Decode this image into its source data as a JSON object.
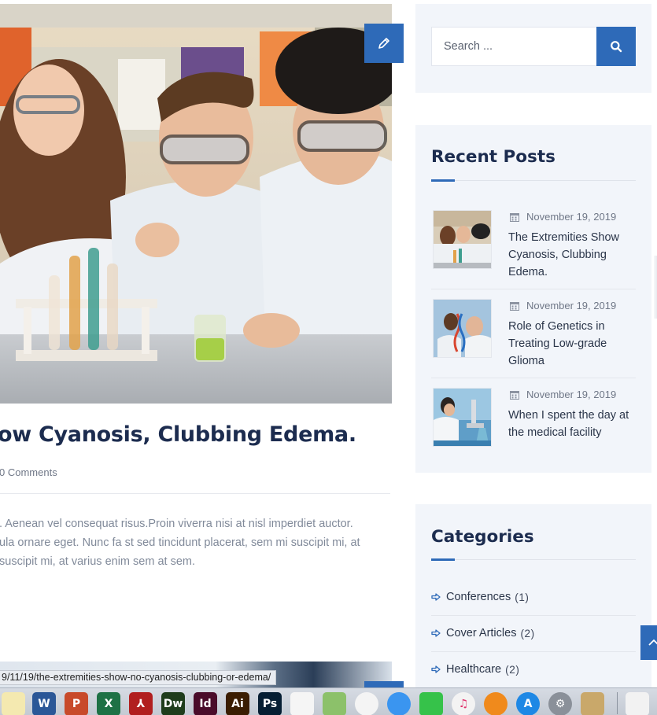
{
  "post": {
    "title": "ow Cyanosis, Clubbing Edema.",
    "meta": "0 Comments",
    "excerpt_lines": [
      ". Aenean vel consequat risus.Proin viverra nisi at nisl imperdiet auctor.",
      "ula ornare eget. Nunc fa st sed tincidunt placerat, sem mi suscipit mi, at",
      "suscipit mi, at varius enim sem at sem."
    ]
  },
  "status_bar": {
    "url": "9/11/19/the-extremities-show-no-cyanosis-clubbing-or-edema/"
  },
  "search": {
    "placeholder": "Search ..."
  },
  "recent_posts": {
    "title": "Recent Posts",
    "items": [
      {
        "date": "November 19, 2019",
        "title": "The Extremities Show Cyanosis, Clubbing Edema."
      },
      {
        "date": "November 19, 2019",
        "title": "Role of Genetics in Treating Low-grade Glioma"
      },
      {
        "date": "November 19, 2019",
        "title": "When I spent the day at the medical facility"
      }
    ]
  },
  "categories": {
    "title": "Categories",
    "items": [
      {
        "label": "Conferences",
        "count": "(1)"
      },
      {
        "label": "Cover Articles",
        "count": "(2)"
      },
      {
        "label": "Healthcare",
        "count": "(2)"
      }
    ]
  },
  "dock": {
    "apps": [
      {
        "name": "notes-icon",
        "label": "",
        "color": "#f4e9b0"
      },
      {
        "name": "word-icon",
        "label": "W",
        "color": "#2b5797"
      },
      {
        "name": "powerpoint-icon",
        "label": "P",
        "color": "#c84a2a"
      },
      {
        "name": "excel-icon",
        "label": "X",
        "color": "#1e7145"
      },
      {
        "name": "acrobat-icon",
        "label": "⅄",
        "color": "#b11f1f"
      },
      {
        "name": "dreamweaver-icon",
        "label": "Dw",
        "color": "#1f3d1c"
      },
      {
        "name": "indesign-icon",
        "label": "Id",
        "color": "#4a0c2a"
      },
      {
        "name": "illustrator-icon",
        "label": "Ai",
        "color": "#3a1d02"
      },
      {
        "name": "photoshop-icon",
        "label": "Ps",
        "color": "#061e33"
      },
      {
        "name": "reminders-icon",
        "label": "",
        "color": "#f5f5f5"
      },
      {
        "name": "maps-icon",
        "label": "",
        "color": "#8cc16a"
      },
      {
        "name": "photos-icon",
        "label": "",
        "color": "#f4f4f4"
      },
      {
        "name": "messages-icon",
        "label": "",
        "color": "#3a95f0"
      },
      {
        "name": "facetime-icon",
        "label": "",
        "color": "#36c24a"
      },
      {
        "name": "itunes-icon",
        "label": "♫",
        "color": "#f3f3f3"
      },
      {
        "name": "ibooks-icon",
        "label": "",
        "color": "#f08a1c"
      },
      {
        "name": "app-store-icon",
        "label": "A",
        "color": "#1e88e5"
      },
      {
        "name": "system-preferences-icon",
        "label": "⚙",
        "color": "#8a9099"
      },
      {
        "name": "preview-icon",
        "label": "",
        "color": "#c9a86a"
      },
      {
        "name": "pdf-document-icon",
        "label": "",
        "color": "#f2f2f2"
      }
    ]
  },
  "colors": {
    "accent": "#2e6ab8",
    "heading": "#1c2c4f",
    "widget_bg": "#f2f5fa"
  }
}
